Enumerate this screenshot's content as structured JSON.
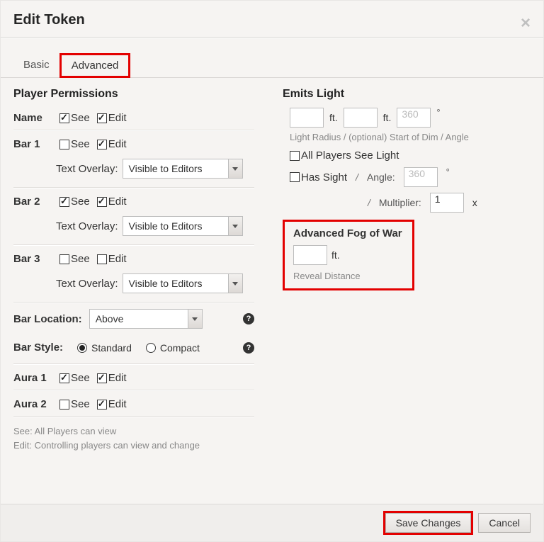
{
  "dialog": {
    "title": "Edit Token",
    "close_symbol": "×"
  },
  "tabs": {
    "basic": "Basic",
    "advanced": "Advanced"
  },
  "permissions": {
    "heading": "Player Permissions",
    "see_label": "See",
    "edit_label": "Edit",
    "text_overlay_label": "Text Overlay:",
    "text_overlay_value": "Visible to Editors",
    "name_label": "Name",
    "bar1_label": "Bar 1",
    "bar2_label": "Bar 2",
    "bar3_label": "Bar 3",
    "bar_loc_label": "Bar Location:",
    "bar_loc_value": "Above",
    "bar_style_label": "Bar Style:",
    "style_standard": "Standard",
    "style_compact": "Compact",
    "aura1_label": "Aura 1",
    "aura2_label": "Aura 2",
    "help_see": "See: All Players can view",
    "help_edit": "Edit: Controlling players can view and change",
    "help_glyph": "?"
  },
  "light": {
    "heading": "Emits Light",
    "ft": "ft.",
    "angle_placeholder": "360",
    "note": "Light Radius / (optional) Start of Dim / Angle",
    "all_players": "All Players See Light",
    "has_sight": "Has Sight",
    "slash": "/",
    "angle_label": "Angle:",
    "multiplier_label": "Multiplier:",
    "multiplier_value": "1",
    "mult_x": "x",
    "deg": "°"
  },
  "afw": {
    "heading": "Advanced Fog of War",
    "ft": "ft.",
    "note": "Reveal Distance"
  },
  "footer": {
    "save": "Save Changes",
    "cancel": "Cancel"
  }
}
